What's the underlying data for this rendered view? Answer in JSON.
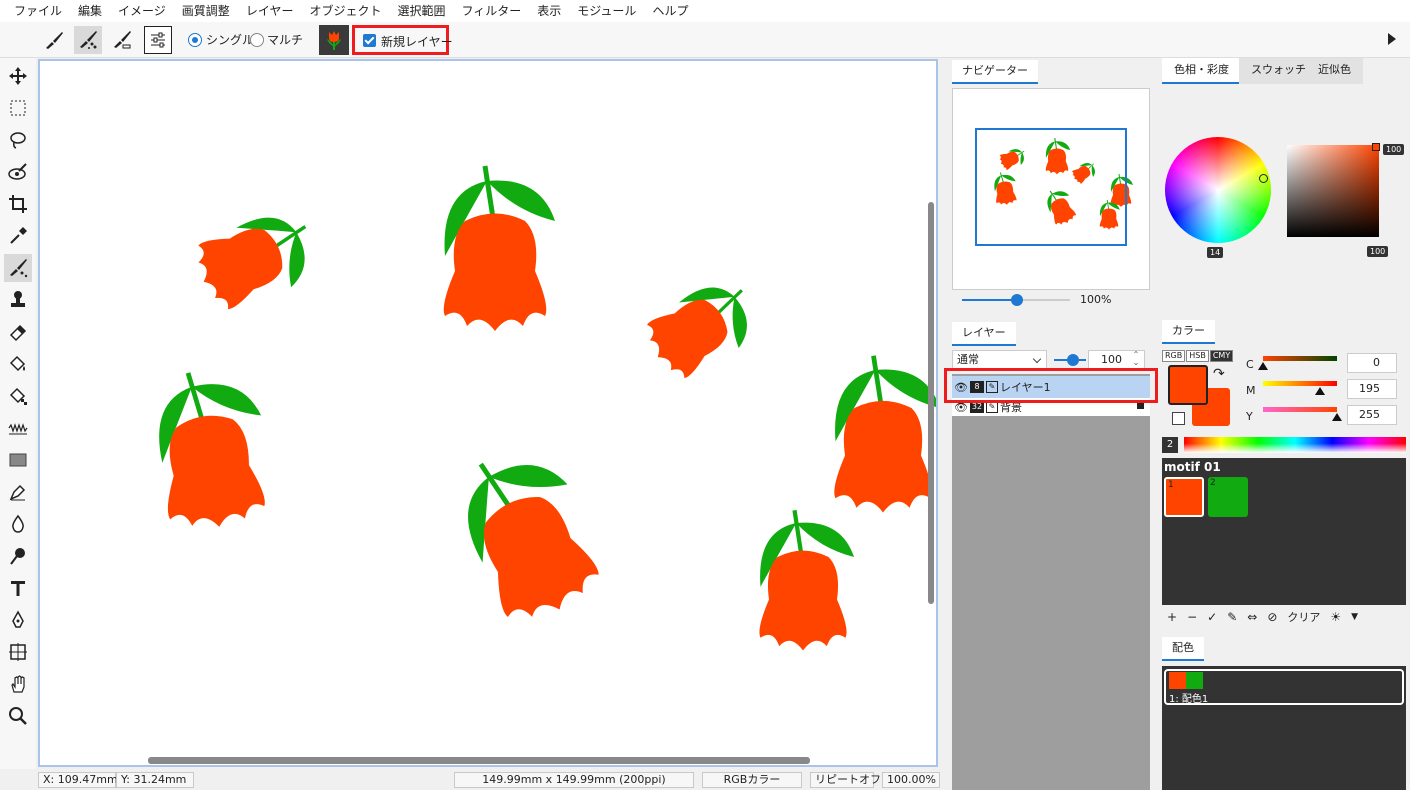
{
  "menu": [
    "ファイル",
    "編集",
    "イメージ",
    "画質調整",
    "レイヤー",
    "オブジェクト",
    "選択範囲",
    "フィルター",
    "表示",
    "モジュール",
    "ヘルプ"
  ],
  "options": {
    "single_label": "シングル",
    "multi_label": "マルチ",
    "new_layer_label": "新規レイヤー",
    "new_layer_checked": true
  },
  "tools": [
    "move-icon",
    "rect-select-icon",
    "lasso-icon",
    "magic-wand-icon",
    "crop-icon",
    "eyedropper-icon",
    "motif-brush-icon",
    "stamp-icon",
    "eraser-icon",
    "fill-icon",
    "pattern-fill-icon",
    "wave-icon",
    "rectangle-icon",
    "pen-edit-icon",
    "drop-icon",
    "smudge-icon",
    "text-icon",
    "pen-icon",
    "transform-icon",
    "hand-icon",
    "zoom-icon"
  ],
  "navigator": {
    "tab": "ナビゲーター",
    "zoom": "100%"
  },
  "layers": {
    "tab": "レイヤー",
    "blend_mode": "通常",
    "opacity": "100",
    "items": [
      {
        "name": "レイヤー1",
        "bits": "8",
        "selected": true
      },
      {
        "name": "背景",
        "bits": "32",
        "selected": false
      }
    ]
  },
  "color": {
    "tabs": [
      "色相・彩度",
      "スウォッチ",
      "近似色"
    ],
    "value_top": "100",
    "value_bottom": "100",
    "hue": "14",
    "panel_tab": "カラー",
    "modes": [
      "RGB",
      "HSB",
      "CMY"
    ],
    "c_label": "C",
    "m_label": "M",
    "y_label": "Y",
    "c": "0",
    "m": "195",
    "y": "255",
    "fg_color": "#ff4400",
    "spectrum_index": "2"
  },
  "motif": {
    "title": "motif 01",
    "swatches": [
      {
        "num": "1",
        "color": "#ff4400"
      },
      {
        "num": "2",
        "color": "#11aa11"
      }
    ],
    "clear_label": "クリア"
  },
  "palette": {
    "tab": "配色",
    "item_label": "1: 配色1"
  },
  "status": {
    "x_label": "X:",
    "x": "109.47mm",
    "y_label": "Y:",
    "y": "31.24mm",
    "size": "149.99mm x 149.99mm (200ppi)",
    "mode": "RGBカラー",
    "repeat": "リピートオフ",
    "zoom": "100.00%"
  }
}
